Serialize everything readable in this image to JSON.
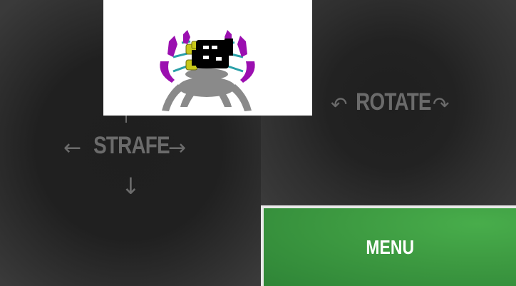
{
  "controls": {
    "strafe_label": "STRAFE",
    "rotate_label": "ROTATE",
    "arrow_left": "←",
    "arrow_right": "→",
    "arrow_down": "↓",
    "rotate_ccw": "↶",
    "rotate_cw": "↷"
  },
  "menu": {
    "label": "MENU"
  },
  "colors": {
    "control_text": "#6b6b6b",
    "menu_green": "#3d9a41",
    "viewport_bg": "#ffffff",
    "robot_purple": "#9b0fb0",
    "robot_yellow": "#c8c81a",
    "robot_teal": "#2aa0a8"
  }
}
